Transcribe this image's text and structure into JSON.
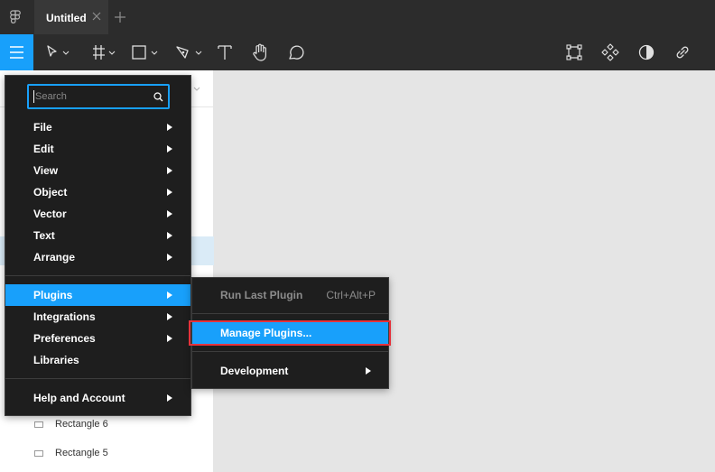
{
  "title_bar": {
    "logo_icon": "figma-logo-icon",
    "tab_title": "Untitled",
    "close_icon": "close-icon",
    "add_tab_icon": "plus-icon"
  },
  "toolbar": {
    "tools": [
      "menu-icon",
      "move-tool-icon",
      "frame-tool-icon",
      "shape-tool-icon",
      "pen-tool-icon",
      "text-tool-icon",
      "hand-tool-icon",
      "comment-tool-icon"
    ],
    "right_tools": [
      "component-icon",
      "components-grid-icon",
      "mask-contrast-icon",
      "link-icon"
    ],
    "accent": "#18a0fb"
  },
  "main_menu": {
    "search_placeholder": "Search",
    "items": [
      {
        "label": "File",
        "has_submenu": true
      },
      {
        "label": "Edit",
        "has_submenu": true
      },
      {
        "label": "View",
        "has_submenu": true
      },
      {
        "label": "Object",
        "has_submenu": true
      },
      {
        "label": "Vector",
        "has_submenu": true
      },
      {
        "label": "Text",
        "has_submenu": true
      },
      {
        "label": "Arrange",
        "has_submenu": true
      },
      {
        "label": "Plugins",
        "has_submenu": true,
        "active": true
      },
      {
        "label": "Integrations",
        "has_submenu": true
      },
      {
        "label": "Preferences",
        "has_submenu": true
      },
      {
        "label": "Libraries",
        "has_submenu": false
      },
      {
        "label": "Help and Account",
        "has_submenu": true
      }
    ]
  },
  "plugins_submenu": {
    "items": [
      {
        "label": "Run Last Plugin",
        "shortcut": "Ctrl+Alt+P",
        "disabled": true
      },
      {
        "label": "Manage Plugins...",
        "active": true
      },
      {
        "label": "Development",
        "has_submenu": true
      }
    ]
  },
  "layers_panel": {
    "layers": [
      {
        "label": "Rectangle 6",
        "icon": "rectangle-icon"
      },
      {
        "label": "Rectangle 5",
        "icon": "rectangle-icon"
      }
    ]
  }
}
